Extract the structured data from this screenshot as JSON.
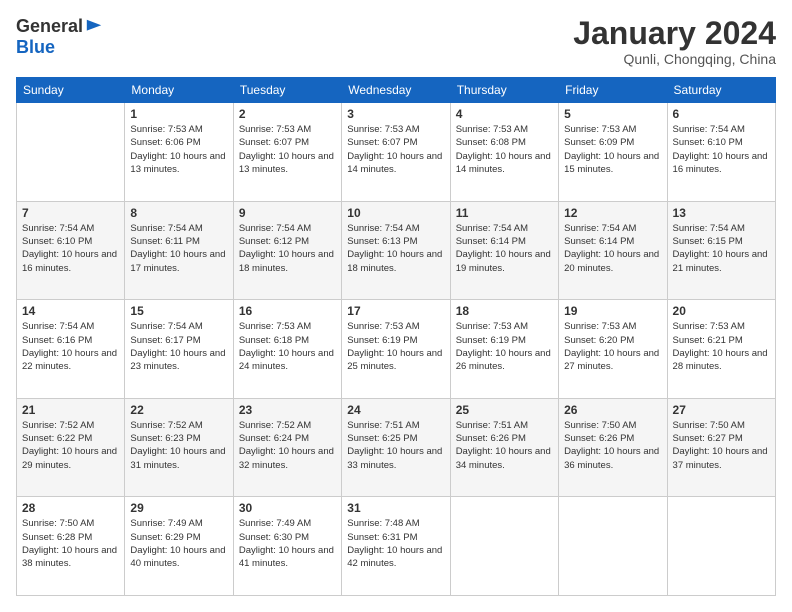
{
  "header": {
    "logo_general": "General",
    "logo_blue": "Blue",
    "month_title": "January 2024",
    "location": "Qunli, Chongqing, China"
  },
  "columns": [
    "Sunday",
    "Monday",
    "Tuesday",
    "Wednesday",
    "Thursday",
    "Friday",
    "Saturday"
  ],
  "weeks": [
    [
      {
        "day": "",
        "sunrise": "",
        "sunset": "",
        "daylight": ""
      },
      {
        "day": "1",
        "sunrise": "Sunrise: 7:53 AM",
        "sunset": "Sunset: 6:06 PM",
        "daylight": "Daylight: 10 hours and 13 minutes."
      },
      {
        "day": "2",
        "sunrise": "Sunrise: 7:53 AM",
        "sunset": "Sunset: 6:07 PM",
        "daylight": "Daylight: 10 hours and 13 minutes."
      },
      {
        "day": "3",
        "sunrise": "Sunrise: 7:53 AM",
        "sunset": "Sunset: 6:07 PM",
        "daylight": "Daylight: 10 hours and 14 minutes."
      },
      {
        "day": "4",
        "sunrise": "Sunrise: 7:53 AM",
        "sunset": "Sunset: 6:08 PM",
        "daylight": "Daylight: 10 hours and 14 minutes."
      },
      {
        "day": "5",
        "sunrise": "Sunrise: 7:53 AM",
        "sunset": "Sunset: 6:09 PM",
        "daylight": "Daylight: 10 hours and 15 minutes."
      },
      {
        "day": "6",
        "sunrise": "Sunrise: 7:54 AM",
        "sunset": "Sunset: 6:10 PM",
        "daylight": "Daylight: 10 hours and 16 minutes."
      }
    ],
    [
      {
        "day": "7",
        "sunrise": "Sunrise: 7:54 AM",
        "sunset": "Sunset: 6:10 PM",
        "daylight": "Daylight: 10 hours and 16 minutes."
      },
      {
        "day": "8",
        "sunrise": "Sunrise: 7:54 AM",
        "sunset": "Sunset: 6:11 PM",
        "daylight": "Daylight: 10 hours and 17 minutes."
      },
      {
        "day": "9",
        "sunrise": "Sunrise: 7:54 AM",
        "sunset": "Sunset: 6:12 PM",
        "daylight": "Daylight: 10 hours and 18 minutes."
      },
      {
        "day": "10",
        "sunrise": "Sunrise: 7:54 AM",
        "sunset": "Sunset: 6:13 PM",
        "daylight": "Daylight: 10 hours and 18 minutes."
      },
      {
        "day": "11",
        "sunrise": "Sunrise: 7:54 AM",
        "sunset": "Sunset: 6:14 PM",
        "daylight": "Daylight: 10 hours and 19 minutes."
      },
      {
        "day": "12",
        "sunrise": "Sunrise: 7:54 AM",
        "sunset": "Sunset: 6:14 PM",
        "daylight": "Daylight: 10 hours and 20 minutes."
      },
      {
        "day": "13",
        "sunrise": "Sunrise: 7:54 AM",
        "sunset": "Sunset: 6:15 PM",
        "daylight": "Daylight: 10 hours and 21 minutes."
      }
    ],
    [
      {
        "day": "14",
        "sunrise": "Sunrise: 7:54 AM",
        "sunset": "Sunset: 6:16 PM",
        "daylight": "Daylight: 10 hours and 22 minutes."
      },
      {
        "day": "15",
        "sunrise": "Sunrise: 7:54 AM",
        "sunset": "Sunset: 6:17 PM",
        "daylight": "Daylight: 10 hours and 23 minutes."
      },
      {
        "day": "16",
        "sunrise": "Sunrise: 7:53 AM",
        "sunset": "Sunset: 6:18 PM",
        "daylight": "Daylight: 10 hours and 24 minutes."
      },
      {
        "day": "17",
        "sunrise": "Sunrise: 7:53 AM",
        "sunset": "Sunset: 6:19 PM",
        "daylight": "Daylight: 10 hours and 25 minutes."
      },
      {
        "day": "18",
        "sunrise": "Sunrise: 7:53 AM",
        "sunset": "Sunset: 6:19 PM",
        "daylight": "Daylight: 10 hours and 26 minutes."
      },
      {
        "day": "19",
        "sunrise": "Sunrise: 7:53 AM",
        "sunset": "Sunset: 6:20 PM",
        "daylight": "Daylight: 10 hours and 27 minutes."
      },
      {
        "day": "20",
        "sunrise": "Sunrise: 7:53 AM",
        "sunset": "Sunset: 6:21 PM",
        "daylight": "Daylight: 10 hours and 28 minutes."
      }
    ],
    [
      {
        "day": "21",
        "sunrise": "Sunrise: 7:52 AM",
        "sunset": "Sunset: 6:22 PM",
        "daylight": "Daylight: 10 hours and 29 minutes."
      },
      {
        "day": "22",
        "sunrise": "Sunrise: 7:52 AM",
        "sunset": "Sunset: 6:23 PM",
        "daylight": "Daylight: 10 hours and 31 minutes."
      },
      {
        "day": "23",
        "sunrise": "Sunrise: 7:52 AM",
        "sunset": "Sunset: 6:24 PM",
        "daylight": "Daylight: 10 hours and 32 minutes."
      },
      {
        "day": "24",
        "sunrise": "Sunrise: 7:51 AM",
        "sunset": "Sunset: 6:25 PM",
        "daylight": "Daylight: 10 hours and 33 minutes."
      },
      {
        "day": "25",
        "sunrise": "Sunrise: 7:51 AM",
        "sunset": "Sunset: 6:26 PM",
        "daylight": "Daylight: 10 hours and 34 minutes."
      },
      {
        "day": "26",
        "sunrise": "Sunrise: 7:50 AM",
        "sunset": "Sunset: 6:26 PM",
        "daylight": "Daylight: 10 hours and 36 minutes."
      },
      {
        "day": "27",
        "sunrise": "Sunrise: 7:50 AM",
        "sunset": "Sunset: 6:27 PM",
        "daylight": "Daylight: 10 hours and 37 minutes."
      }
    ],
    [
      {
        "day": "28",
        "sunrise": "Sunrise: 7:50 AM",
        "sunset": "Sunset: 6:28 PM",
        "daylight": "Daylight: 10 hours and 38 minutes."
      },
      {
        "day": "29",
        "sunrise": "Sunrise: 7:49 AM",
        "sunset": "Sunset: 6:29 PM",
        "daylight": "Daylight: 10 hours and 40 minutes."
      },
      {
        "day": "30",
        "sunrise": "Sunrise: 7:49 AM",
        "sunset": "Sunset: 6:30 PM",
        "daylight": "Daylight: 10 hours and 41 minutes."
      },
      {
        "day": "31",
        "sunrise": "Sunrise: 7:48 AM",
        "sunset": "Sunset: 6:31 PM",
        "daylight": "Daylight: 10 hours and 42 minutes."
      },
      {
        "day": "",
        "sunrise": "",
        "sunset": "",
        "daylight": ""
      },
      {
        "day": "",
        "sunrise": "",
        "sunset": "",
        "daylight": ""
      },
      {
        "day": "",
        "sunrise": "",
        "sunset": "",
        "daylight": ""
      }
    ]
  ]
}
